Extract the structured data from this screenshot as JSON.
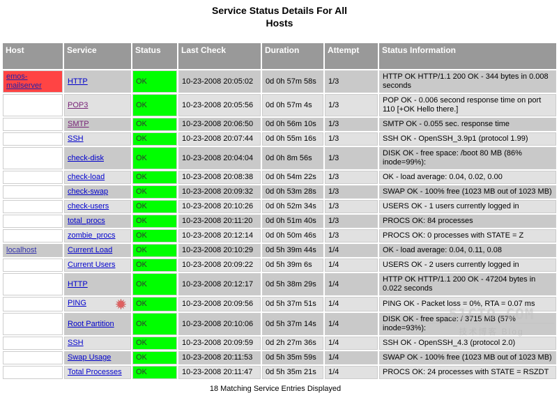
{
  "page": {
    "title_line1": "Service Status Details For All",
    "title_line2": "Hosts",
    "footer": "18 Matching Service Entries Displayed"
  },
  "watermark": {
    "main": "51CTO.COM",
    "sub": "技术博客  Blog"
  },
  "icons": {
    "sort_asc": "▲",
    "sort_desc": "▼",
    "flapping": "starburst-icon"
  },
  "colors": {
    "header_bg": "#999999",
    "ok_green": "#00ff00",
    "host_down_red": "#ff4444",
    "row_dark": "#c9c9c9",
    "row_light": "#e1e1e1",
    "sort_up_arrow": "#ffaa44",
    "sort_down_arrow": "#44dd44",
    "link": "#0000cc",
    "link_visited": "#772277"
  },
  "table": {
    "columns": [
      {
        "label": "Host",
        "sort_up": true,
        "sort_down": true
      },
      {
        "label": "Service",
        "sort_up": true,
        "sort_down": true
      },
      {
        "label": "Status",
        "sort_up": true,
        "sort_down": true
      },
      {
        "label": "Last Check",
        "sort_up": true,
        "sort_down": true
      },
      {
        "label": "Duration",
        "sort_up": true,
        "sort_down": true
      },
      {
        "label": "Attempt",
        "sort_up": true,
        "sort_down": true
      },
      {
        "label": "Status Information",
        "sort_up": false,
        "sort_down": false
      }
    ],
    "rows": [
      {
        "host": "emos-mailserver",
        "host_state": "down",
        "service": "HTTP",
        "service_visited": false,
        "flapping": false,
        "status": "OK",
        "last_check": "10-23-2008 20:05:02",
        "duration": "0d 0h 57m 58s",
        "attempt": "1/3",
        "info": "HTTP OK HTTP/1.1 200 OK - 344 bytes in 0.008 seconds",
        "shade": "dark"
      },
      {
        "host": "",
        "host_state": "none",
        "service": "POP3",
        "service_visited": true,
        "flapping": false,
        "status": "OK",
        "last_check": "10-23-2008 20:05:56",
        "duration": "0d 0h 57m 4s",
        "attempt": "1/3",
        "info": "POP OK - 0.006 second response time on port 110 [+OK Hello there.]",
        "shade": "light"
      },
      {
        "host": "",
        "host_state": "none",
        "service": "SMTP",
        "service_visited": true,
        "flapping": false,
        "status": "OK",
        "last_check": "10-23-2008 20:06:50",
        "duration": "0d 0h 56m 10s",
        "attempt": "1/3",
        "info": "SMTP OK - 0.055 sec. response time",
        "shade": "dark"
      },
      {
        "host": "",
        "host_state": "none",
        "service": "SSH",
        "service_visited": false,
        "flapping": false,
        "status": "OK",
        "last_check": "10-23-2008 20:07:44",
        "duration": "0d 0h 55m 16s",
        "attempt": "1/3",
        "info": "SSH OK - OpenSSH_3.9p1 (protocol 1.99)",
        "shade": "light"
      },
      {
        "host": "",
        "host_state": "none",
        "service": "check-disk",
        "service_visited": false,
        "flapping": false,
        "status": "OK",
        "last_check": "10-23-2008 20:04:04",
        "duration": "0d 0h 8m 56s",
        "attempt": "1/3",
        "info": "DISK OK - free space: /boot 80 MB (86% inode=99%):",
        "shade": "dark"
      },
      {
        "host": "",
        "host_state": "none",
        "service": "check-load",
        "service_visited": false,
        "flapping": false,
        "status": "OK",
        "last_check": "10-23-2008 20:08:38",
        "duration": "0d 0h 54m 22s",
        "attempt": "1/3",
        "info": "OK - load average: 0.04, 0.02, 0.00",
        "shade": "light"
      },
      {
        "host": "",
        "host_state": "none",
        "service": "check-swap",
        "service_visited": false,
        "flapping": false,
        "status": "OK",
        "last_check": "10-23-2008 20:09:32",
        "duration": "0d 0h 53m 28s",
        "attempt": "1/3",
        "info": "SWAP OK - 100% free (1023 MB out of 1023 MB)",
        "shade": "dark"
      },
      {
        "host": "",
        "host_state": "none",
        "service": "check-users",
        "service_visited": false,
        "flapping": false,
        "status": "OK",
        "last_check": "10-23-2008 20:10:26",
        "duration": "0d 0h 52m 34s",
        "attempt": "1/3",
        "info": "USERS OK - 1 users currently logged in",
        "shade": "light"
      },
      {
        "host": "",
        "host_state": "none",
        "service": "total_procs",
        "service_visited": false,
        "flapping": false,
        "status": "OK",
        "last_check": "10-23-2008 20:11:20",
        "duration": "0d 0h 51m 40s",
        "attempt": "1/3",
        "info": "PROCS OK: 84 processes",
        "shade": "dark"
      },
      {
        "host": "",
        "host_state": "none",
        "service": "zombie_procs",
        "service_visited": false,
        "flapping": false,
        "status": "OK",
        "last_check": "10-23-2008 20:12:14",
        "duration": "0d 0h 50m 46s",
        "attempt": "1/3",
        "info": "PROCS OK: 0 processes with STATE = Z",
        "shade": "light"
      },
      {
        "host": "localhost",
        "host_state": "up",
        "service": "Current Load",
        "service_visited": false,
        "flapping": false,
        "status": "OK",
        "last_check": "10-23-2008 20:10:29",
        "duration": "0d 5h 39m 44s",
        "attempt": "1/4",
        "info": "OK - load average: 0.04, 0.11, 0.08",
        "shade": "dark"
      },
      {
        "host": "",
        "host_state": "none",
        "service": "Current Users",
        "service_visited": false,
        "flapping": false,
        "status": "OK",
        "last_check": "10-23-2008 20:09:22",
        "duration": "0d 5h 39m 6s",
        "attempt": "1/4",
        "info": "USERS OK - 2 users currently logged in",
        "shade": "light"
      },
      {
        "host": "",
        "host_state": "none",
        "service": "HTTP",
        "service_visited": false,
        "flapping": false,
        "status": "OK",
        "last_check": "10-23-2008 20:12:17",
        "duration": "0d 5h 38m 29s",
        "attempt": "1/4",
        "info": "HTTP OK HTTP/1.1 200 OK - 47204 bytes in 0.022 seconds",
        "shade": "dark"
      },
      {
        "host": "",
        "host_state": "none",
        "service": "PING",
        "service_visited": false,
        "flapping": true,
        "status": "OK",
        "last_check": "10-23-2008 20:09:56",
        "duration": "0d 5h 37m 51s",
        "attempt": "1/4",
        "info": "PING OK - Packet loss = 0%, RTA = 0.07 ms",
        "shade": "light"
      },
      {
        "host": "",
        "host_state": "none",
        "service": "Root Partition",
        "service_visited": false,
        "flapping": false,
        "status": "OK",
        "last_check": "10-23-2008 20:10:06",
        "duration": "0d 5h 37m 14s",
        "attempt": "1/4",
        "info": "DISK OK - free space: / 3715 MB (57% inode=93%):",
        "shade": "dark"
      },
      {
        "host": "",
        "host_state": "none",
        "service": "SSH",
        "service_visited": false,
        "flapping": false,
        "status": "OK",
        "last_check": "10-23-2008 20:09:59",
        "duration": "0d 2h 27m 36s",
        "attempt": "1/4",
        "info": "SSH OK - OpenSSH_4.3 (protocol 2.0)",
        "shade": "light"
      },
      {
        "host": "",
        "host_state": "none",
        "service": "Swap Usage",
        "service_visited": false,
        "flapping": false,
        "status": "OK",
        "last_check": "10-23-2008 20:11:53",
        "duration": "0d 5h 35m 59s",
        "attempt": "1/4",
        "info": "SWAP OK - 100% free (1023 MB out of 1023 MB)",
        "shade": "dark"
      },
      {
        "host": "",
        "host_state": "none",
        "service": "Total Processes",
        "service_visited": false,
        "flapping": false,
        "status": "OK",
        "last_check": "10-23-2008 20:11:47",
        "duration": "0d 5h 35m 21s",
        "attempt": "1/4",
        "info": "PROCS OK: 24 processes with STATE = RSZDT",
        "shade": "light"
      }
    ]
  }
}
